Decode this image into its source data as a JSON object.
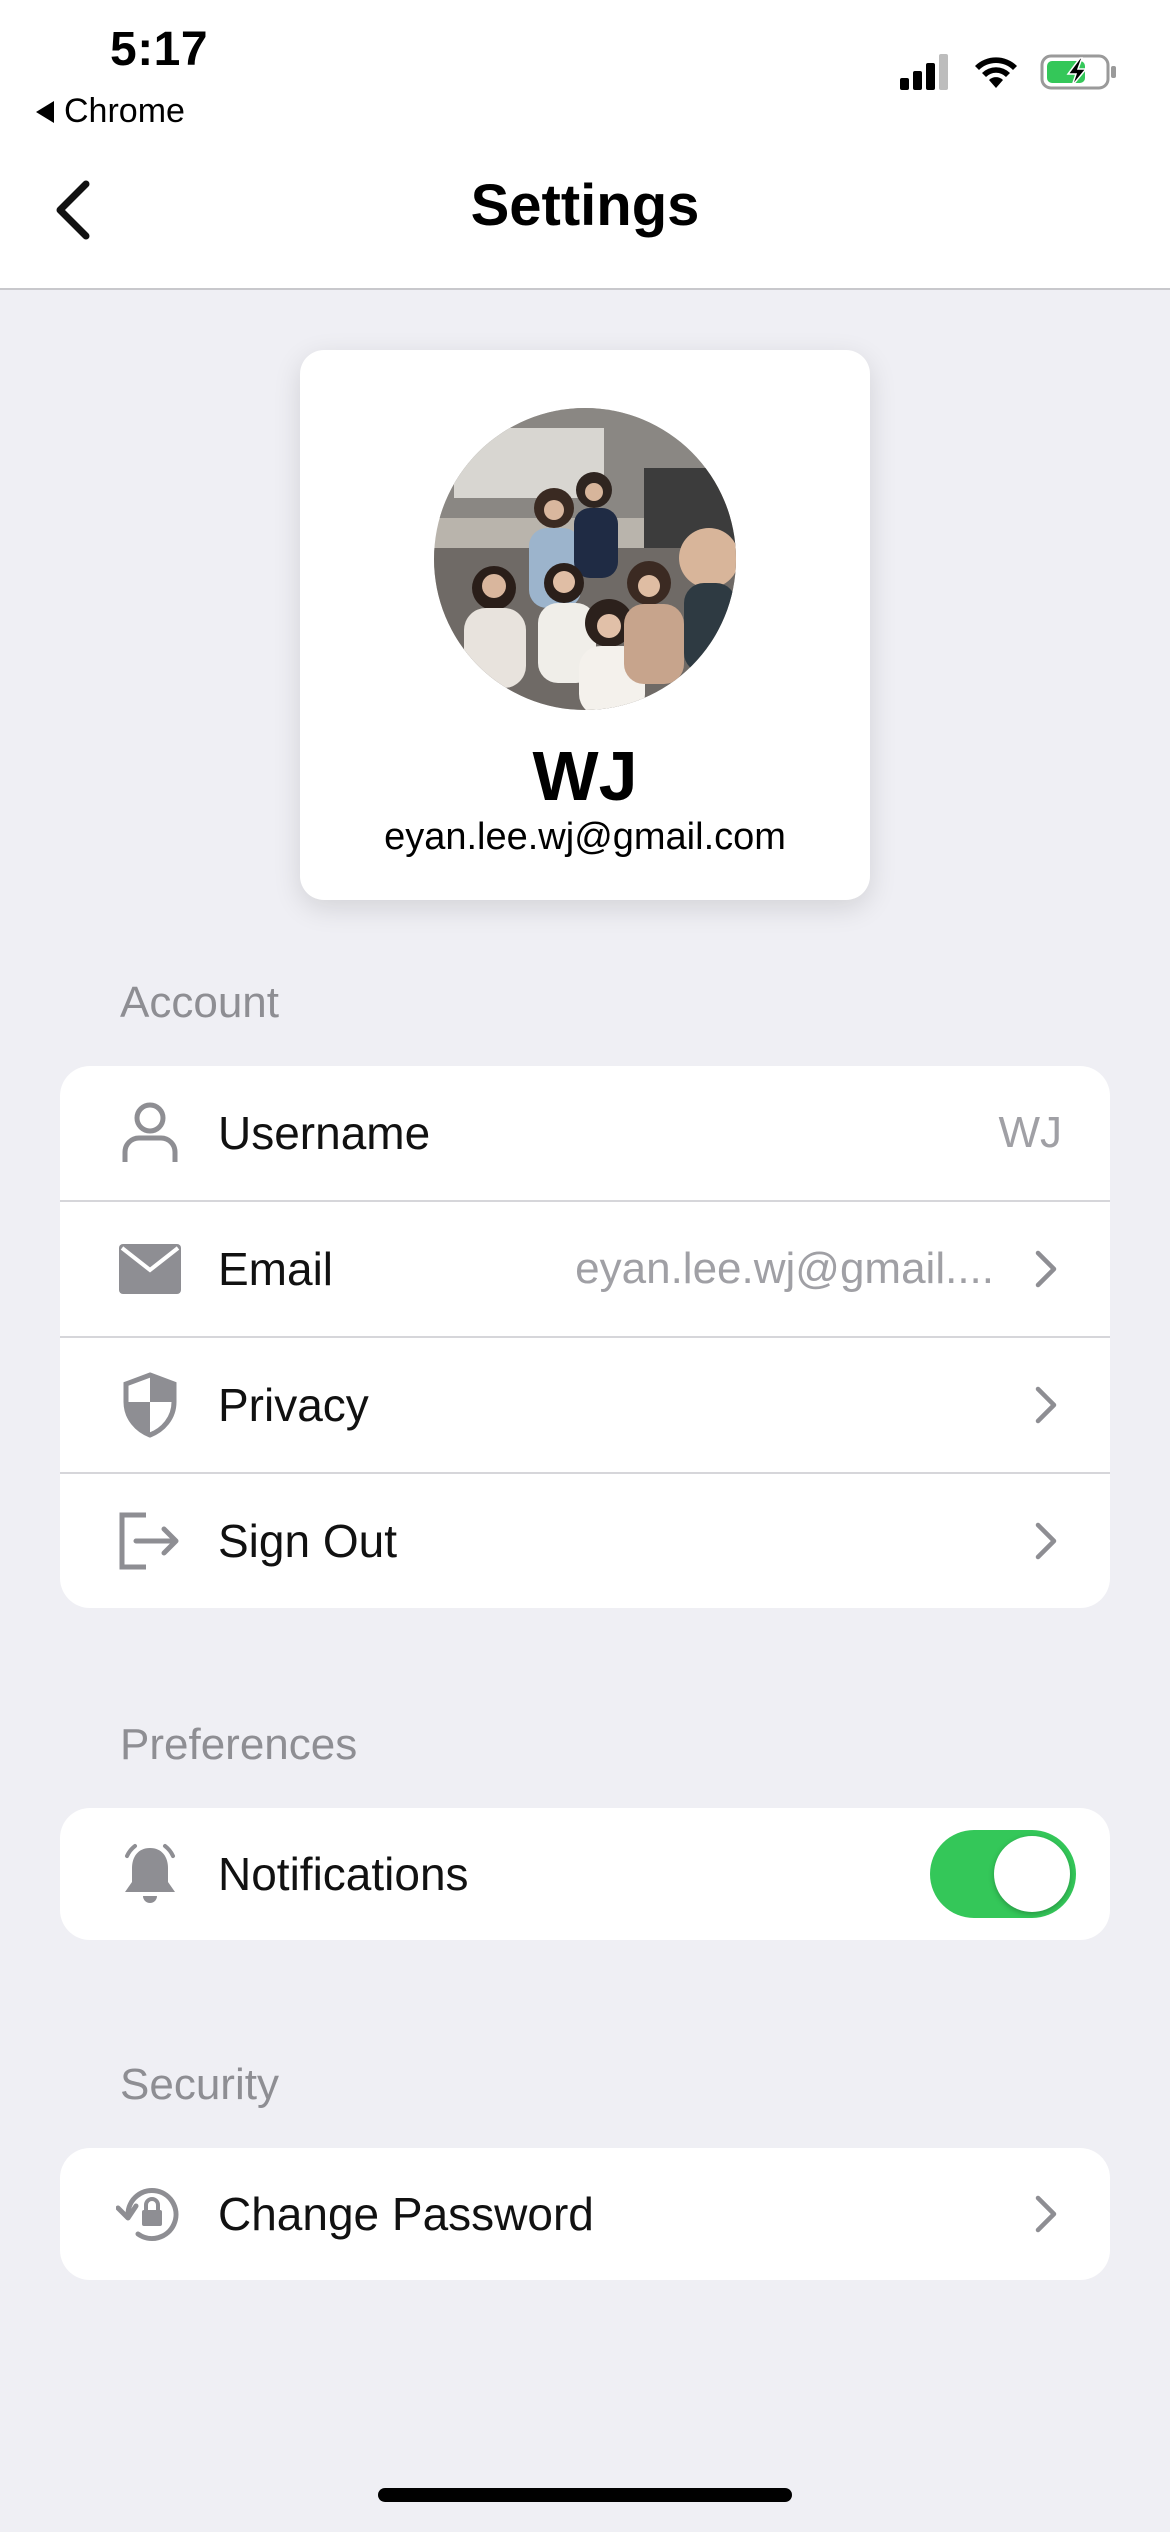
{
  "status_bar": {
    "time": "5:17",
    "back_app": "Chrome"
  },
  "header": {
    "title": "Settings"
  },
  "profile": {
    "name": "WJ",
    "email": "eyan.lee.wj@gmail.com"
  },
  "sections": {
    "account": {
      "label": "Account",
      "rows": [
        {
          "label": "Username",
          "value": "WJ",
          "icon": "person-icon"
        },
        {
          "label": "Email",
          "value": "eyan.lee.wj@gmail....",
          "icon": "mail-icon"
        },
        {
          "label": "Privacy",
          "icon": "shield-icon"
        },
        {
          "label": "Sign Out",
          "icon": "sign-out-icon"
        }
      ]
    },
    "preferences": {
      "label": "Preferences",
      "rows": [
        {
          "label": "Notifications",
          "toggle_on": true,
          "icon": "bell-icon"
        }
      ]
    },
    "security": {
      "label": "Security",
      "rows": [
        {
          "label": "Change Password",
          "icon": "lock-reset-icon"
        }
      ]
    }
  },
  "colors": {
    "accent_toggle": "#34c759",
    "background": "#efeff4",
    "secondary_text": "#8e8e93",
    "battery": "#34c759"
  }
}
